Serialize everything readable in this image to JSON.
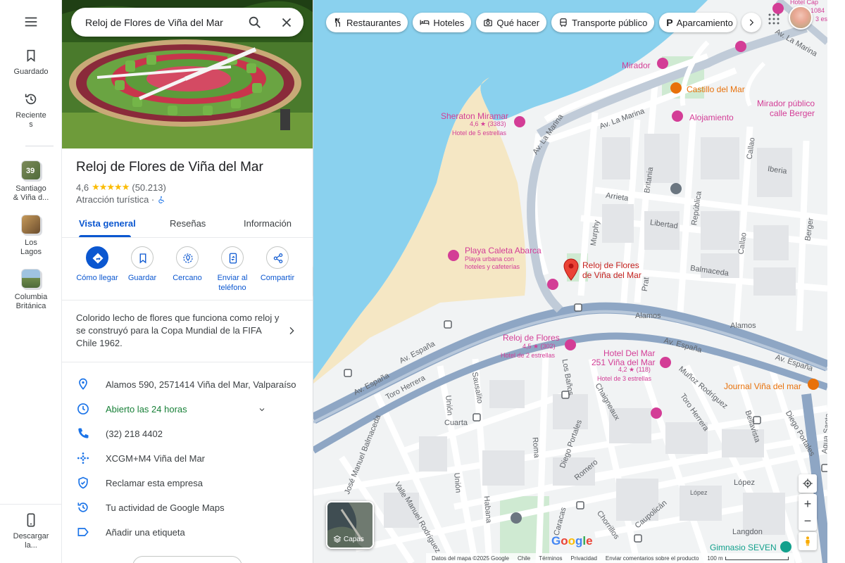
{
  "rail": {
    "menu_icon": "hamburger-menu-icon",
    "saved_label": "Guardado",
    "recent_label_1": "Reciente",
    "recent_label_2": "s",
    "recent_places": [
      {
        "line1": "Santiago",
        "line2": "& Viña d...",
        "badge": "39"
      },
      {
        "line1": "Los",
        "line2": "Lagos"
      },
      {
        "line1": "Columbia",
        "line2": "Británica"
      }
    ],
    "download_label_1": "Descargar",
    "download_label_2": "la..."
  },
  "search": {
    "value": "Reloj de Flores de Viña del Mar"
  },
  "place": {
    "title": "Reloj de Flores de Viña del Mar",
    "rating": "4,6",
    "stars": "★★★★★",
    "reviews": "(50.213)",
    "category": "Atracción turística ·",
    "tabs": [
      "Vista general",
      "Reseñas",
      "Información"
    ],
    "actions": [
      {
        "label1": "Cómo llegar",
        "label2": ""
      },
      {
        "label1": "Guardar",
        "label2": ""
      },
      {
        "label1": "Cercano",
        "label2": ""
      },
      {
        "label1": "Enviar al",
        "label2": "teléfono"
      },
      {
        "label1": "Compartir",
        "label2": ""
      }
    ],
    "description": "Colorido lecho de flores que funciona como reloj y se construyó para la Copa Mundial de la FIFA Chile 1962.",
    "address": "Alamos 590, 2571414 Viña del Mar, Valparaíso",
    "hours": "Abierto las 24 horas",
    "phone": "(32) 218 4402",
    "plus_code": "XCGM+M4 Viña del Mar",
    "claim": "Reclamar esta empresa",
    "activity": "Tu actividad de Google Maps",
    "add_label": "Añadir una etiqueta"
  },
  "chips": [
    "Restaurantes",
    "Hoteles",
    "Qué hacer",
    "Transporte público",
    "Aparcamiento"
  ],
  "map": {
    "pois": {
      "mirador": "Mirador",
      "castillo": "Castillo del Mar",
      "alojamiento": "Alojamiento",
      "mirador_publico_1": "Mirador público",
      "mirador_publico_2": "calle Berger",
      "sheraton": "Sheraton Miramar",
      "sheraton_rating": "4,6 ★ (3383)",
      "sheraton_class": "Hotel de 5 estrellas",
      "playa": "Playa Caleta Abarca",
      "playa_sub_1": "Playa urbana con",
      "playa_sub_2": "hoteles y cafeterías",
      "reloj_1": "Reloj de Flores",
      "reloj_2": "de Viña del Mar",
      "hotel_reloj": "Reloj de Flores",
      "hotel_reloj_rating": "4,5 ★ (302)",
      "hotel_reloj_class": "Hotel de 2 estrellas",
      "hotel_delmar_1": "Hotel Del Mar",
      "hotel_delmar_2": "251 Viña del Mar",
      "hotel_delmar_rating": "4,2 ★ (118)",
      "hotel_delmar_class": "Hotel de 3 estrellas",
      "journal": "Journal Viña del mar",
      "gimnasio": "Gimnasio SEVEN",
      "hotel_cap": "Hotel Cap",
      "hotel_cap_count": "1084",
      "hotel_cap_class": "3 es"
    },
    "roads": {
      "av_la_marina_1": "Av. La Marina",
      "av_la_marina_2": "Av. La Marina",
      "av_la_marina_3": "Av. La Marina",
      "arrieta": "Arrieta",
      "britania": "Britania",
      "libertad": "Libertad",
      "republica": "República",
      "iberia": "Iberia",
      "callao_1": "Callao",
      "callao_2": "Callao",
      "berger": "Berger",
      "murphy": "Murphy",
      "balmaceda": "Balmaceda",
      "prat": "Prat",
      "alamos_1": "Alamos",
      "alamos_2": "Alamos",
      "av_espana_1": "Av. España",
      "av_espana_2": "Av. España",
      "av_espana_3": "Av. España",
      "av_espana_4": "Av. España",
      "toro_herrera_1": "Toro Herrera",
      "toro_herrera_2": "Toro Herrera",
      "sausalito": "Sausalito",
      "los_banos": "Los Baños",
      "chaigneaux": "Chaigneaux",
      "munoz": "Muñoz Rodríguez",
      "bellavista": "Bellavista",
      "diego_portales_1": "Diego Portales",
      "diego_portales_2": "Diego Portales",
      "union_1": "Unión",
      "union_2": "Unión",
      "cuarta": "Cuarta",
      "roma": "Roma",
      "romero": "Romero",
      "jose_manuel_balmaceda": "José Manuel Balmaceda",
      "valle": "Valle",
      "manuel_rodriguez": "Manuel Rodríguez",
      "habana": "Habana",
      "caracas": "Caracas",
      "chorrillos": "Chorrillos",
      "caupolican": "Caupolicán",
      "lopez_1": "López",
      "lopez_2": "López",
      "langdon": "Langdon",
      "agua_santa": "Agua Santa"
    },
    "layers_label": "Capas",
    "google_logo": "Google",
    "footer": [
      "Datos del mapa ©2025 Google",
      "Chile",
      "Términos",
      "Privacidad",
      "Enviar comentarios sobre el producto",
      "100 m"
    ],
    "colors": {
      "water": "#8ad1ee",
      "land": "#f1f3f4",
      "highway": "#8ea6c4",
      "poi_pink": "#d33d96",
      "poi_orange": "#e8710a",
      "marker_red": "#ea4335",
      "accent_blue": "#0b57d0"
    }
  }
}
